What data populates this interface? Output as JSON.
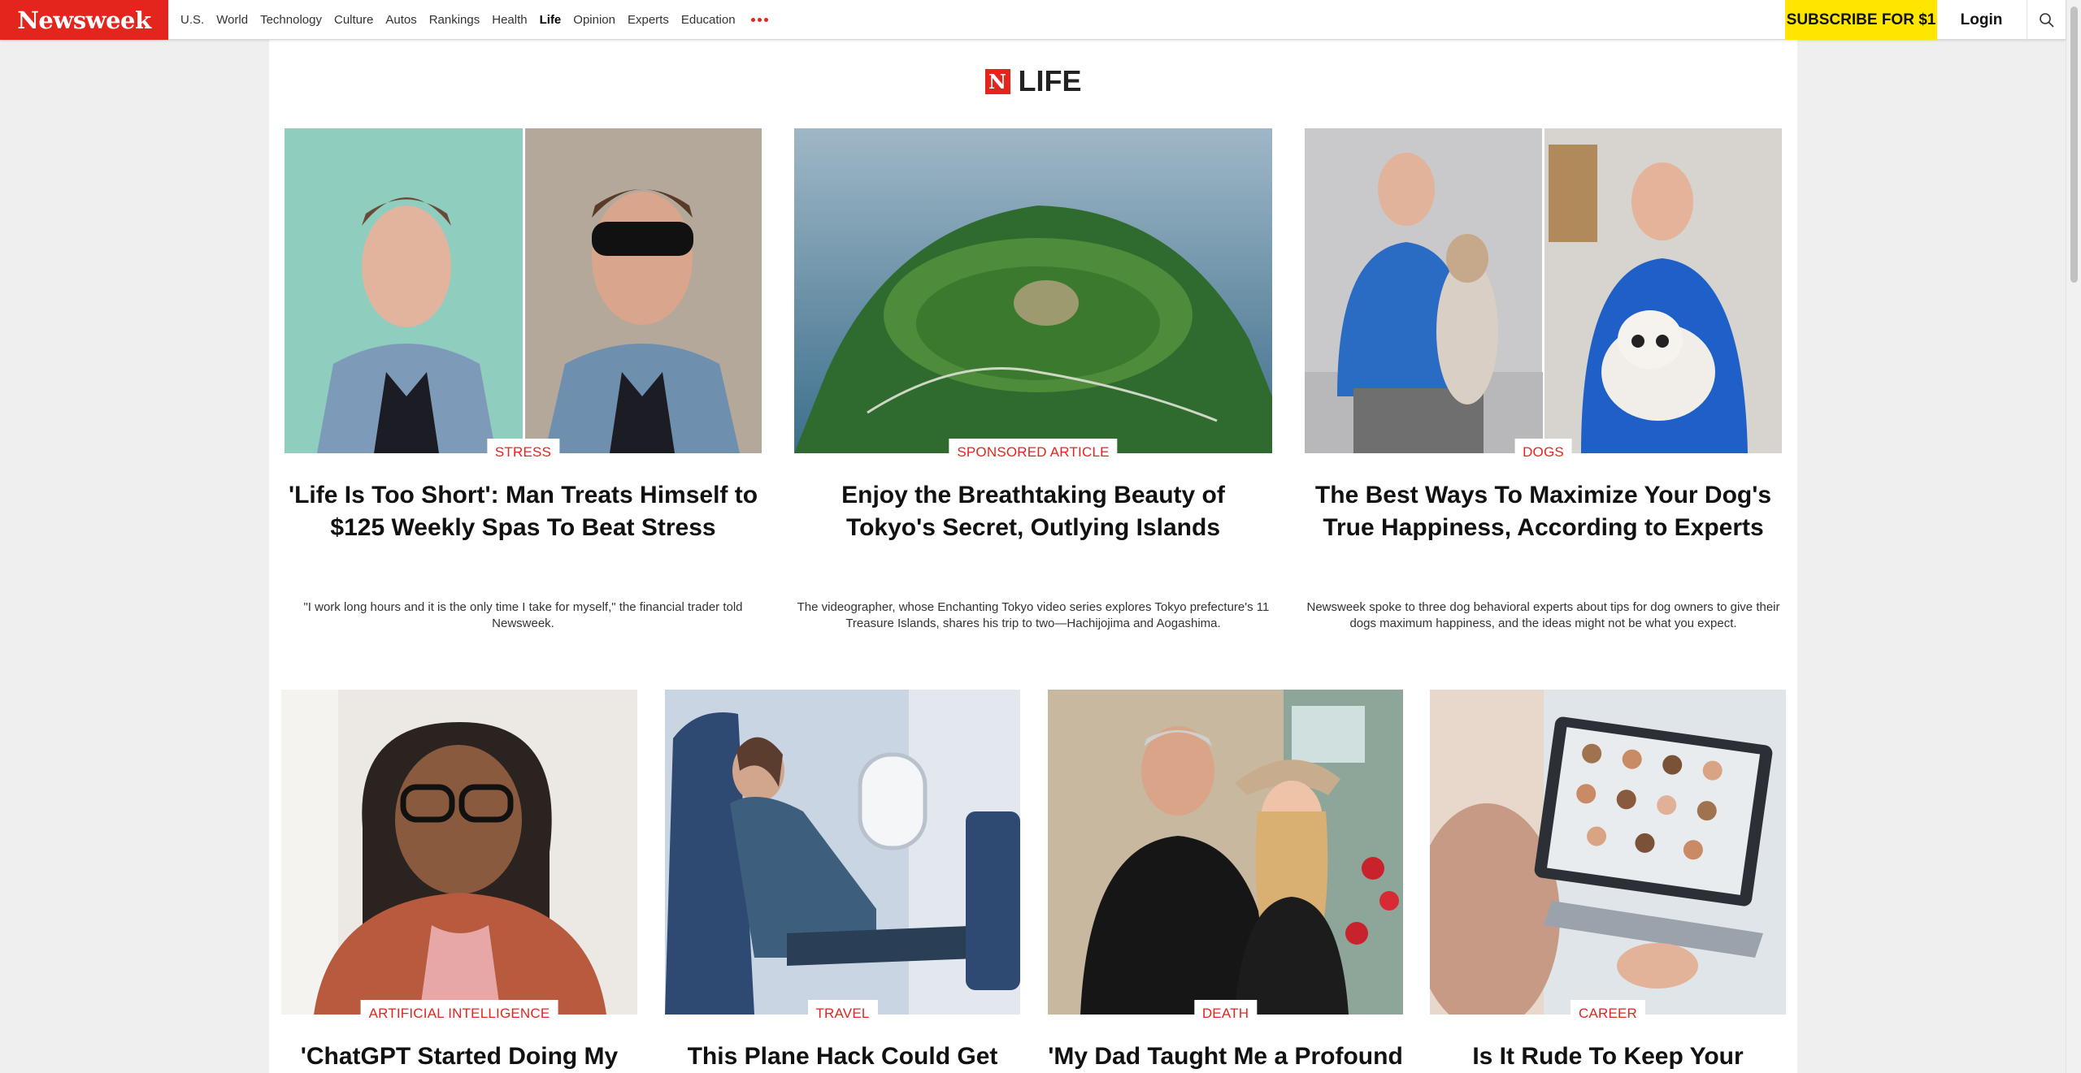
{
  "brand": {
    "name": "Newsweek",
    "accent": "#e4251e",
    "subscribe_bg": "#ffe600"
  },
  "nav": {
    "items": [
      "U.S.",
      "World",
      "Technology",
      "Culture",
      "Autos",
      "Rankings",
      "Health",
      "Life",
      "Opinion",
      "Experts",
      "Education"
    ],
    "active": "Life",
    "subscribe_label": "SUBSCRIBE FOR $1",
    "login_label": "Login"
  },
  "section": {
    "badge": "N",
    "title": "LIFE"
  },
  "top_articles": [
    {
      "category": "STRESS",
      "headline": "'Life Is Too Short': Man Treats Himself to $125 Weekly Spas To Beat Stress",
      "description": "\"I work long hours and it is the only time I take for myself,\" the financial trader told Newsweek."
    },
    {
      "category": "SPONSORED ARTICLE",
      "headline": "Enjoy the Breathtaking Beauty of Tokyo's Secret, Outlying Islands",
      "description": "The videographer, whose Enchanting Tokyo video series explores Tokyo prefecture's 11 Treasure Islands, shares his trip to two—Hachijojima and Aogashima."
    },
    {
      "category": "DOGS",
      "headline": "The Best Ways To Maximize Your Dog's True Happiness, According to Experts",
      "description": "Newsweek spoke to three dog behavioral experts about tips for dog owners to give their dogs maximum happiness, and the ideas might not be what you expect."
    }
  ],
  "bottom_articles": [
    {
      "category": "ARTIFICIAL INTELLIGENCE",
      "headline": "'ChatGPT Started Doing My Job,"
    },
    {
      "category": "TRAVEL",
      "headline": "This Plane Hack Could Get You"
    },
    {
      "category": "DEATH",
      "headline": "'My Dad Taught Me a Profound"
    },
    {
      "category": "CAREER",
      "headline": "Is It Rude To Keep Your Camera"
    }
  ]
}
